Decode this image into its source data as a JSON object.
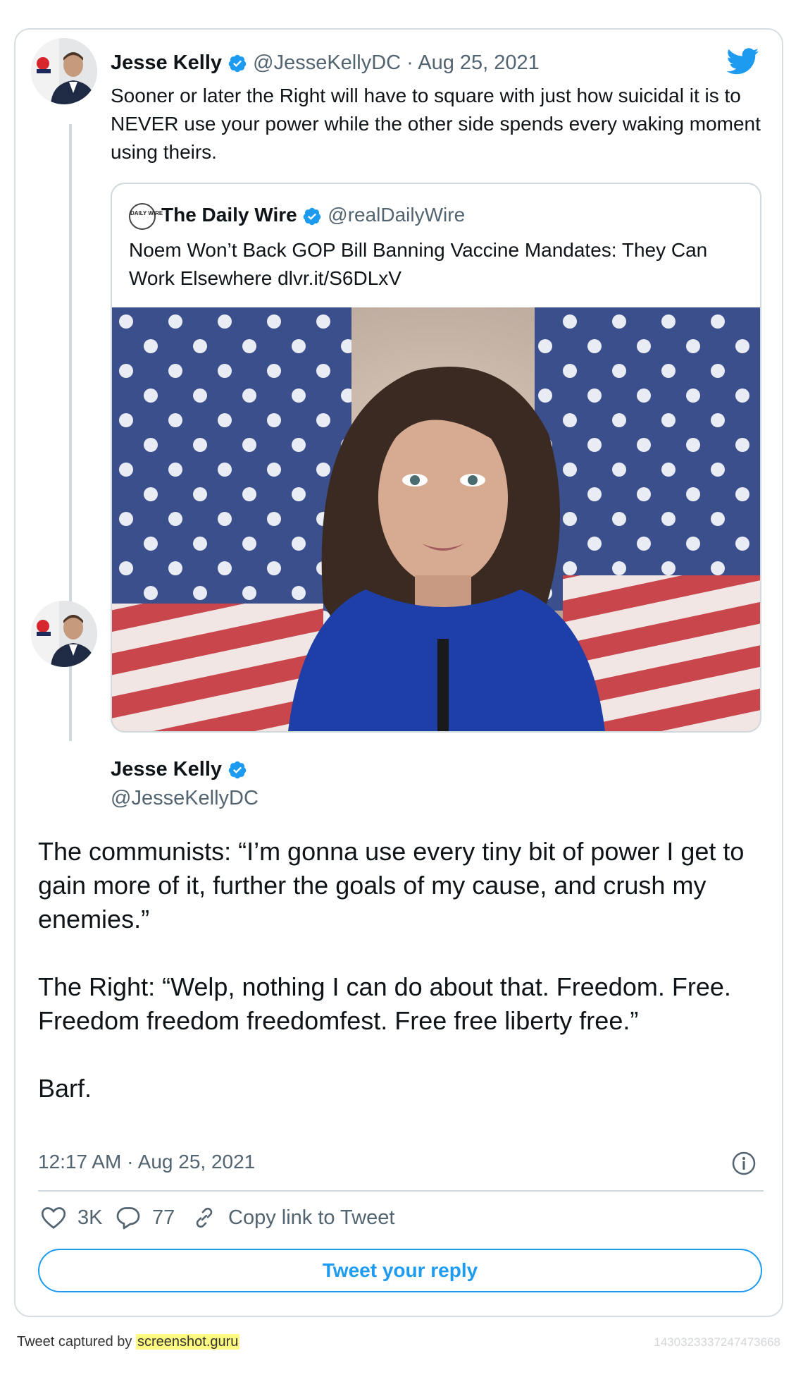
{
  "main_tweet": {
    "author_name": "Jesse Kelly",
    "handle": "@JesseKellyDC",
    "date_sep": " · ",
    "date": "Aug 25, 2021",
    "text": "Sooner or later the Right will have to square with just how suicidal it is to NEVER use your power while the other side spends every waking moment using theirs."
  },
  "quoted_tweet": {
    "author_name": "The Daily Wire",
    "logo_text": "DAILY WIRE",
    "handle": "@realDailyWire",
    "text": "Noem Won’t Back GOP Bill Banning Vaccine Mandates: They Can Work Elsewhere dlvr.it/S6DLxV"
  },
  "reply_tweet": {
    "author_name": "Jesse Kelly",
    "handle": "@JesseKellyDC",
    "paragraphs": [
      "The communists: “I’m gonna use every tiny bit of power I get to gain more of it, further the goals of my cause, and crush my enemies.”",
      "The Right: “Welp, nothing I can do about that. Freedom. Free. Freedom freedom freedomfest. Free free liberty free.”",
      "Barf."
    ],
    "timestamp": "12:17 AM · Aug 25, 2021"
  },
  "actions": {
    "likes": "3K",
    "replies": "77",
    "copy_link": "Copy link to Tweet",
    "reply_button": "Tweet your reply"
  },
  "footer": {
    "captured_by": "Tweet captured by ",
    "site": "screenshot.guru",
    "tweet_id": "1430323337247473668"
  },
  "colors": {
    "accent": "#1d9bf0",
    "muted_text": "#536471",
    "border": "#cfd9de"
  },
  "icons": [
    "twitter-bird-icon",
    "verified-badge-icon",
    "heart-icon",
    "comment-icon",
    "link-icon",
    "info-icon"
  ]
}
